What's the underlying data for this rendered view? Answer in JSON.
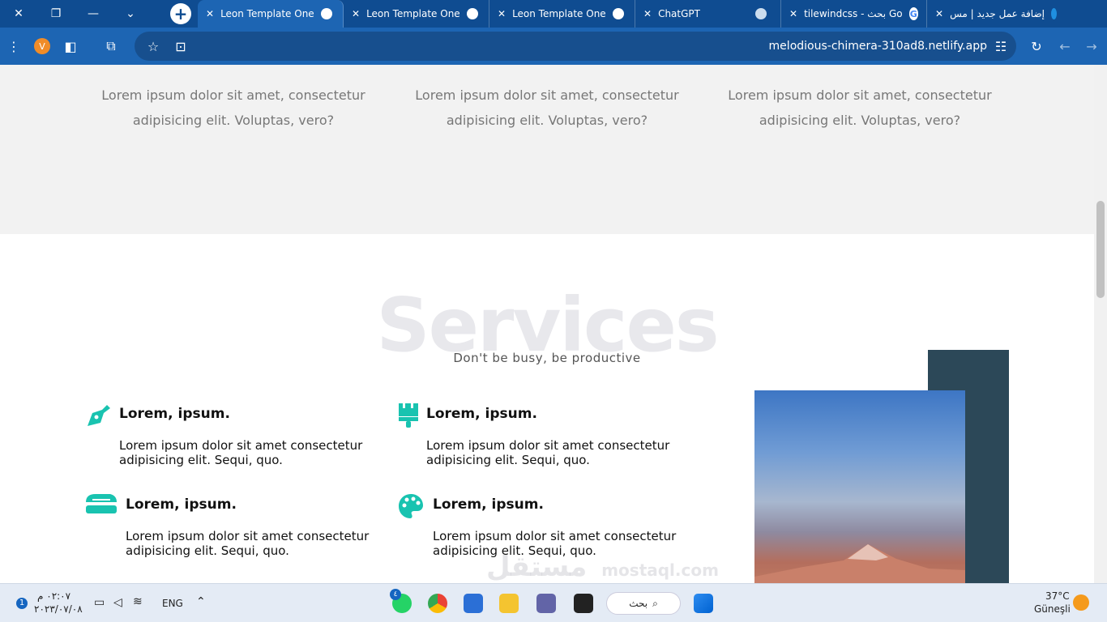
{
  "browser": {
    "tabs": [
      {
        "label": "Leon Template One",
        "active": true
      },
      {
        "label": "Leon Template One",
        "active": false
      },
      {
        "label": "Leon Template One",
        "active": false
      },
      {
        "label": "ChatGPT",
        "active": false
      },
      {
        "label": "tilewindcss - بحث Go",
        "active": false
      },
      {
        "label": "إضافة عمل جديد | مس",
        "active": false
      }
    ],
    "profile_initial": "V",
    "url": "melodious-chimera-310ad8.netlify.app"
  },
  "page": {
    "columns": [
      {
        "text": "Lorem ipsum dolor sit amet, consectetur adipisicing elit. Voluptas, vero?"
      },
      {
        "text": "Lorem ipsum dolor sit amet, consectetur adipisicing elit. Voluptas, vero?"
      },
      {
        "text": "Lorem ipsum dolor sit amet, consectetur adipisicing elit. Voluptas, vero?"
      }
    ],
    "services_title": "Services",
    "services_subtitle": "Don't be busy, be productive",
    "services": [
      {
        "title": "Lorem, ipsum.",
        "desc": "Lorem ipsum dolor sit amet consectetur adipisicing elit. Sequi, quo.",
        "icon": "pen-nib-icon"
      },
      {
        "title": "Lorem, ipsum.",
        "desc": "Lorem ipsum dolor sit amet consectetur adipisicing elit. Sequi, quo.",
        "icon": "paint-brush-icon"
      },
      {
        "title": "Lorem, ipsum.",
        "desc": "Lorem ipsum dolor sit amet consectetur adipisicing elit. Sequi, quo.",
        "icon": "stapler-icon"
      },
      {
        "title": "Lorem, ipsum.",
        "desc": "Lorem ipsum dolor sit amet consectetur adipisicing elit. Sequi, quo.",
        "icon": "palette-icon"
      }
    ],
    "accent": "#19c3b0",
    "dark_block": "#2c4858"
  },
  "taskbar": {
    "time": "٠٢:٠٧ م",
    "date": "٢٠٢٣/٠٧/٠٨",
    "notification_count": "1",
    "lang": "ENG",
    "search_label": "بحث",
    "whatsapp_badge": "٤",
    "weather_temp": "37°C",
    "weather_desc": "Güneşli"
  },
  "watermark": "مستقل",
  "watermark_url": "mostaql.com"
}
